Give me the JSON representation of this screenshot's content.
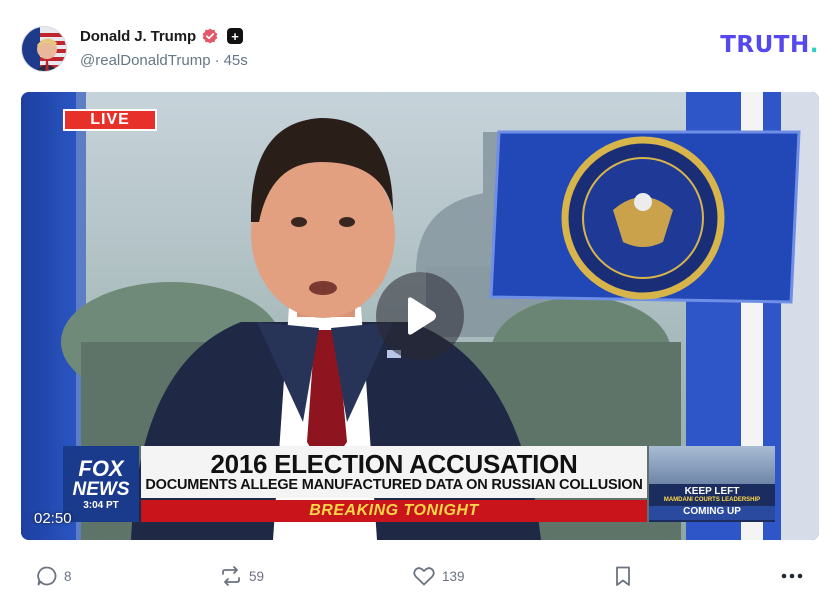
{
  "post": {
    "author_name": "Donald J. Trump",
    "handle": "@realDonaldTrump",
    "separator": "·",
    "time_ago": "45s"
  },
  "brand": {
    "logo_text": "TRUTH",
    "logo_dot": ".",
    "logo_color": "#5448ee",
    "dot_color": "#2fd0c4"
  },
  "video": {
    "live_label": "LIVE",
    "duration": "02:50",
    "network_top": "FOX",
    "network_bottom": "NEWS",
    "network_time": "3:04 PT",
    "headline": "2016 ELECTION ACCUSATION",
    "subheadline": "DOCUMENTS ALLEGE MANUFACTURED DATA ON RUSSIAN COLLUSION",
    "breaking": "BREAKING TONIGHT",
    "promo_title": "KEEP LEFT",
    "promo_subtitle": "MAMDANI COURTS LEADERSHIP",
    "promo_tag": "COMING UP"
  },
  "actions": {
    "replies": "8",
    "retruths": "59",
    "likes": "139"
  },
  "icons": [
    "verified-icon",
    "plus-icon",
    "play-icon",
    "reply-icon",
    "retruth-icon",
    "like-icon",
    "bookmark-icon",
    "more-icon"
  ]
}
